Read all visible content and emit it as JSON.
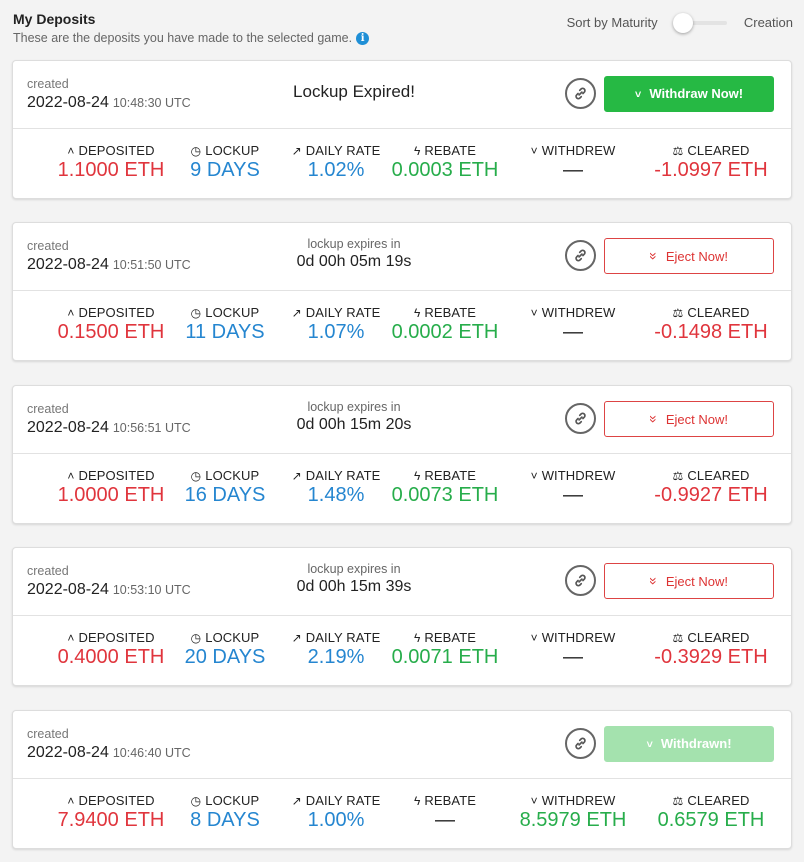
{
  "header": {
    "title": "My Deposits",
    "subtitle": "These are the deposits you have made to the selected game.",
    "info_icon": "i",
    "sort_left": "Sort by Maturity",
    "sort_right": "Creation"
  },
  "stat_labels": {
    "deposited": "DEPOSITED",
    "lockup": "LOCKUP",
    "daily_rate": "DAILY RATE",
    "rebate": "REBATE",
    "withdrew": "WITHDREW",
    "cleared": "CLEARED"
  },
  "icons": {
    "deposited": "chevron-up-icon",
    "lockup": "clock-icon",
    "daily_rate": "chart-line-icon",
    "rebate": "bolt-icon",
    "withdrew": "chevron-down-icon",
    "cleared": "balance-scale-icon",
    "link": "link-icon"
  },
  "colors": {
    "red": "#e0353d",
    "blue": "#2586d0",
    "green": "#27ad4b",
    "withdraw_button": "#26b944",
    "withdrawn_button": "#a4e2ae"
  },
  "deposits": [
    {
      "created_label": "created",
      "date": "2022-08-24",
      "time": "10:48:30 UTC",
      "status_title": "Lockup Expired!",
      "button": "Withdraw Now!",
      "deposited": "1.1000 ETH",
      "lockup": "9 DAYS",
      "daily_rate": "1.02%",
      "rebate": "0.0003 ETH",
      "withdrew": "—",
      "cleared": "-1.0997 ETH"
    },
    {
      "created_label": "created",
      "date": "2022-08-24",
      "time": "10:51:50 UTC",
      "status_sub": "lockup expires in",
      "status_time": "0d 00h 05m 19s",
      "button": "Eject Now!",
      "deposited": "0.1500 ETH",
      "lockup": "11 DAYS",
      "daily_rate": "1.07%",
      "rebate": "0.0002 ETH",
      "withdrew": "—",
      "cleared": "-0.1498 ETH"
    },
    {
      "created_label": "created",
      "date": "2022-08-24",
      "time": "10:56:51 UTC",
      "status_sub": "lockup expires in",
      "status_time": "0d 00h 15m 20s",
      "button": "Eject Now!",
      "deposited": "1.0000 ETH",
      "lockup": "16 DAYS",
      "daily_rate": "1.48%",
      "rebate": "0.0073 ETH",
      "withdrew": "—",
      "cleared": "-0.9927 ETH"
    },
    {
      "created_label": "created",
      "date": "2022-08-24",
      "time": "10:53:10 UTC",
      "status_sub": "lockup expires in",
      "status_time": "0d 00h 15m 39s",
      "button": "Eject Now!",
      "deposited": "0.4000 ETH",
      "lockup": "20 DAYS",
      "daily_rate": "2.19%",
      "rebate": "0.0071 ETH",
      "withdrew": "—",
      "cleared": "-0.3929 ETH"
    },
    {
      "created_label": "created",
      "date": "2022-08-24",
      "time": "10:46:40 UTC",
      "button": "Withdrawn!",
      "deposited": "7.9400 ETH",
      "lockup": "8 DAYS",
      "daily_rate": "1.00%",
      "rebate": "—",
      "withdrew": "8.5979 ETH",
      "cleared": "0.6579 ETH"
    }
  ]
}
